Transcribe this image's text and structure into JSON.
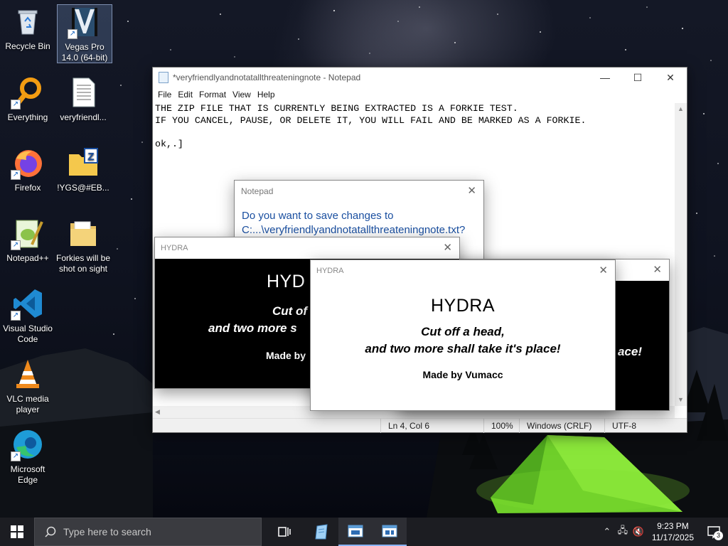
{
  "desktop": {
    "icons": [
      {
        "label": "Recycle Bin",
        "icon": "recycle-bin-icon"
      },
      {
        "label": "Vegas Pro 14.0 (64-bit)",
        "icon": "vegas-pro-icon"
      },
      {
        "label": "Everything",
        "icon": "everything-search-icon"
      },
      {
        "label": "veryfriendl...",
        "icon": "text-file-icon"
      },
      {
        "label": "Firefox",
        "icon": "firefox-icon"
      },
      {
        "label": "!YGS@#EB...",
        "icon": "zip-folder-icon"
      },
      {
        "label": "Notepad++",
        "icon": "notepad-plus-plus-icon"
      },
      {
        "label": "Forkies will be shot on sight",
        "icon": "folder-icon"
      },
      {
        "label": "Visual Studio Code",
        "icon": "vscode-icon"
      },
      {
        "label": "VLC media player",
        "icon": "vlc-icon"
      },
      {
        "label": "Microsoft Edge",
        "icon": "edge-icon"
      }
    ]
  },
  "notepad": {
    "title": "*veryfriendlyandnotatallthreateningnote - Notepad",
    "menu": [
      "File",
      "Edit",
      "Format",
      "View",
      "Help"
    ],
    "content": "THE ZIP FILE THAT IS CURRENTLY BEING EXTRACTED IS A FORKIE TEST.\nIF YOU CANCEL, PAUSE, OR DELETE IT, YOU WILL FAIL AND BE MARKED AS A FORKIE.\n\nok,.]",
    "status": {
      "position": "Ln 4, Col 6",
      "zoom": "100%",
      "line_ending": "Windows (CRLF)",
      "encoding": "UTF-8"
    }
  },
  "save_dialog": {
    "title": "Notepad",
    "message_line1": "Do you want to save changes to",
    "message_line2": "C:...\\veryfriendlyandnotatallthreateningnote.txt?"
  },
  "hydra": {
    "window_title": "HYDRA",
    "heading": "HYDRA",
    "line1": "Cut off a head,",
    "line2": "and two more shall take it's place!",
    "credit": "Made by Vumacc",
    "partial_left": {
      "heading": "HYD",
      "line1": "Cut of",
      "line2": "and two more s",
      "credit": "Made by"
    },
    "partial_right": {
      "line2": "ace!"
    }
  },
  "taskbar": {
    "search_placeholder": "Type here to search",
    "time": "9:23 PM",
    "date": "11/17/2025",
    "notification_count": "3"
  },
  "colors": {
    "taskbar": "#1c1d22",
    "dialog_text": "#1a4fa0",
    "hydra_dark": "#000000",
    "tent_glow": "#7fe030"
  }
}
